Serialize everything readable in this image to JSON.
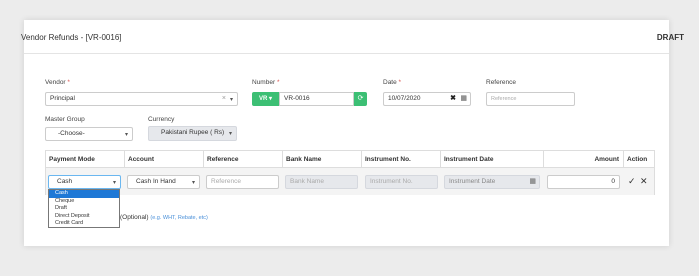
{
  "header": {
    "title": "Vendor Refunds - [VR-0016]",
    "status": "DRAFT"
  },
  "vendor": {
    "label": "Vendor",
    "value": "Principal"
  },
  "number": {
    "label": "Number",
    "prefix": "VR",
    "value": "VR-0016"
  },
  "date": {
    "label": "Date",
    "value": "10/07/2020"
  },
  "reference": {
    "label": "Reference",
    "placeholder": "Reference"
  },
  "master_group": {
    "label": "Master Group",
    "value": "-Choose-"
  },
  "currency": {
    "label": "Currency",
    "value": "Pakistani Rupee ( Rs)"
  },
  "table": {
    "headers": {
      "payment_mode": "Payment Mode",
      "account": "Account",
      "reference": "Reference",
      "bank_name": "Bank Name",
      "instrument_no": "Instrument No.",
      "instrument_date": "Instrument Date",
      "amount": "Amount",
      "action": "Action"
    },
    "row": {
      "payment_mode": "Cash",
      "account": "Cash In Hand",
      "reference_ph": "Reference",
      "bank_name_ph": "Bank Name",
      "instrument_no_ph": "Instrument No.",
      "instrument_date_ph": "Instrument Date",
      "amount": "0"
    }
  },
  "payment_mode_options": [
    "Cash",
    "Cheque",
    "Draft",
    "Direct Deposit",
    "Credit Card"
  ],
  "optional": {
    "text": "(Optional)",
    "hint": "(e.g. WHT, Rebate, etc)"
  },
  "icons": {
    "check": "check-icon",
    "close": "close-icon",
    "calendar": "calendar-icon",
    "refresh": "refresh-icon"
  },
  "colors": {
    "accent": "#3cbf74",
    "required": "#d9534f",
    "selected": "#1e78d6"
  }
}
